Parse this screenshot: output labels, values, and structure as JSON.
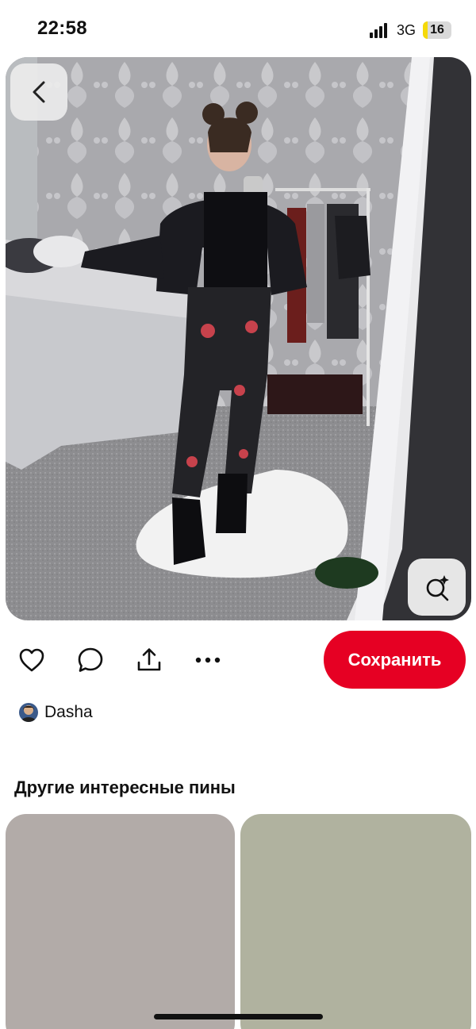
{
  "status_bar": {
    "time": "22:58",
    "network": "3G",
    "battery": "16",
    "battery_percent": 16
  },
  "pin": {
    "back_icon": "chevron-left-icon",
    "visual_search_icon": "lens-sparkle-icon"
  },
  "actions": {
    "like_icon": "heart-icon",
    "comment_icon": "comment-bubble-icon",
    "share_icon": "share-upload-icon",
    "more_icon": "more-dots-icon",
    "save_label": "Сохранить"
  },
  "author": {
    "name": "Dasha"
  },
  "more_pins": {
    "title": "Другие интересные пины"
  },
  "colors": {
    "accent": "#e60023",
    "card_left": "#b2aba8",
    "card_right": "#b0b29f"
  }
}
